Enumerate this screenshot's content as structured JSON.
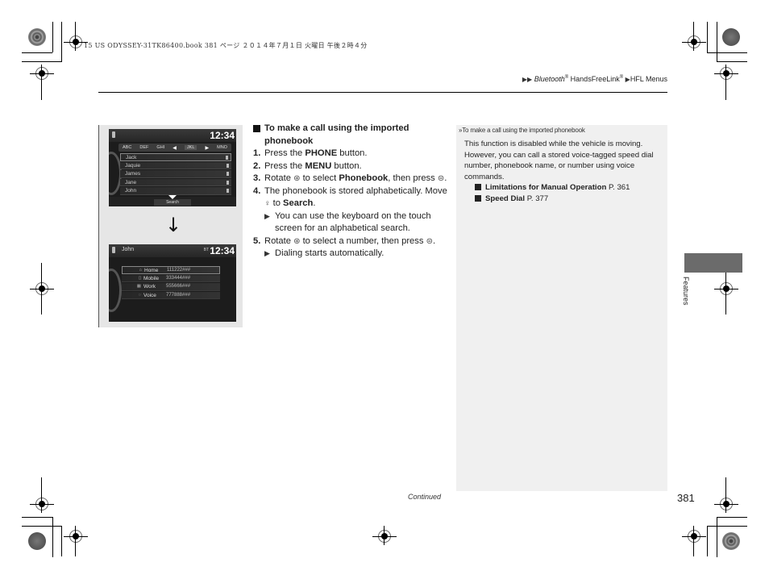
{
  "print_header": "15 US ODYSSEY-31TK86400.book  381 ページ  ２０１４年７月１日  火曜日  午後２時４分",
  "breadcrumb": {
    "items": [
      "Bluetooth® HandsFreeLink®",
      "HFL Menus"
    ],
    "first_italic": "Bluetooth",
    "first_rest": " HandsFreeLink",
    "second": "HFL Menus"
  },
  "figure": {
    "screen1": {
      "clock": "12:34",
      "tabs": [
        "ABC",
        "DEF",
        "GHI",
        "JKL",
        "MNO"
      ],
      "selected_tab": "JKL",
      "contacts": [
        "Jack",
        "Jaquie",
        "James",
        "Jane",
        "John"
      ],
      "search_label": "Search"
    },
    "screen2": {
      "contact": "John",
      "clock": "12:34",
      "status": "BT",
      "numbers": [
        {
          "icon": "home-icon",
          "glyph": "⌂",
          "label": "Home",
          "number": "111222###"
        },
        {
          "icon": "mobile-icon",
          "glyph": "▯",
          "label": "Mobile",
          "number": "333444###"
        },
        {
          "icon": "work-icon",
          "glyph": "▦",
          "label": "Work",
          "number": "555666###"
        },
        {
          "icon": "voice-icon",
          "glyph": "◌",
          "label": "Voice",
          "number": "777888###"
        }
      ]
    }
  },
  "instructions": {
    "title": "To make a call using the imported phonebook",
    "steps": [
      {
        "n": "1.",
        "pre": "Press the ",
        "bold": "PHONE",
        "post": " button."
      },
      {
        "n": "2.",
        "pre": "Press the ",
        "bold": "MENU",
        "post": " button."
      },
      {
        "n": "3.",
        "pre": "Rotate ",
        "icon": "⊛",
        "mid": " to select ",
        "bold": "Phonebook",
        "post": ", then press ",
        "icon2": "⊜",
        "end": "."
      },
      {
        "n": "4.",
        "pre": "The phonebook is stored alphabetically. Move ",
        "icon": "♀",
        "mid": " to ",
        "bold": "Search",
        "post": "."
      },
      {
        "n": "5.",
        "pre": "Rotate ",
        "icon": "⊛",
        "mid": " to select a number, then press ",
        "icon2": "⊜",
        "end": "."
      }
    ],
    "sub4": "You can use the keyboard on the touch screen for an alphabetical search.",
    "sub5": "Dialing starts automatically."
  },
  "note": {
    "title": "To make a call using the imported phonebook",
    "body": "This function is disabled while the vehicle is moving. However, you can call a stored voice-tagged speed dial number, phonebook name, or number using voice commands.",
    "refs": [
      {
        "bold": "Limitations for Manual Operation",
        "page": " P. 361"
      },
      {
        "bold": "Speed Dial",
        "page": " P. 377"
      }
    ]
  },
  "side_label": "Features",
  "footer": {
    "continued": "Continued",
    "page_number": "381"
  }
}
